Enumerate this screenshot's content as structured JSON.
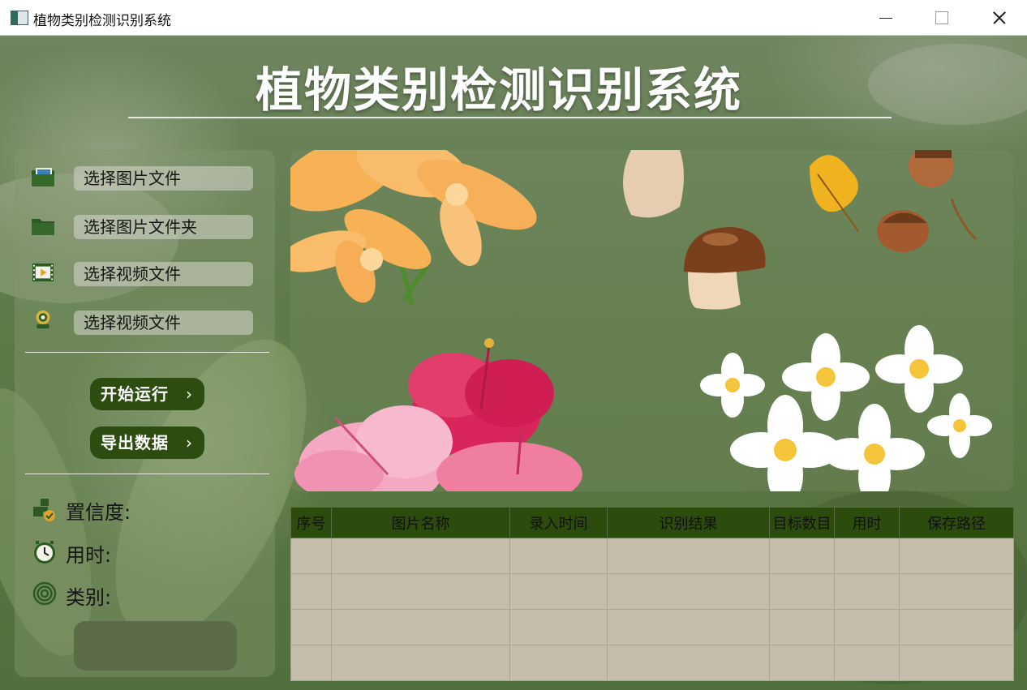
{
  "window": {
    "title": "植物类别检测识别系统"
  },
  "header": {
    "title": "植物类别检测识别系统"
  },
  "sidebar": {
    "menu": [
      {
        "label": "选择图片文件",
        "icon": "image-folder-icon"
      },
      {
        "label": "选择图片文件夹",
        "icon": "folder-icon"
      },
      {
        "label": "选择视频文件",
        "icon": "video-file-icon"
      },
      {
        "label": "选择视频文件",
        "icon": "webcam-icon"
      }
    ],
    "actions": [
      {
        "label": "开始运行",
        "chevron": "›"
      },
      {
        "label": "导出数据",
        "chevron": "›"
      }
    ],
    "info": [
      {
        "label": "置信度:",
        "icon": "confidence-icon"
      },
      {
        "label": "用时:",
        "icon": "clock-icon"
      },
      {
        "label": "类别:",
        "icon": "target-icon"
      }
    ]
  },
  "table": {
    "headers": [
      "序号",
      "图片名称",
      "录入时间",
      "识别结果",
      "目标数目",
      "用时",
      "保存路径"
    ],
    "row_count": 4
  },
  "colors": {
    "accent_dark_green": "#2c4c10",
    "table_header": "#2c4c0d",
    "table_body": "#c3bdaa",
    "result_box": "#5b6b48"
  }
}
